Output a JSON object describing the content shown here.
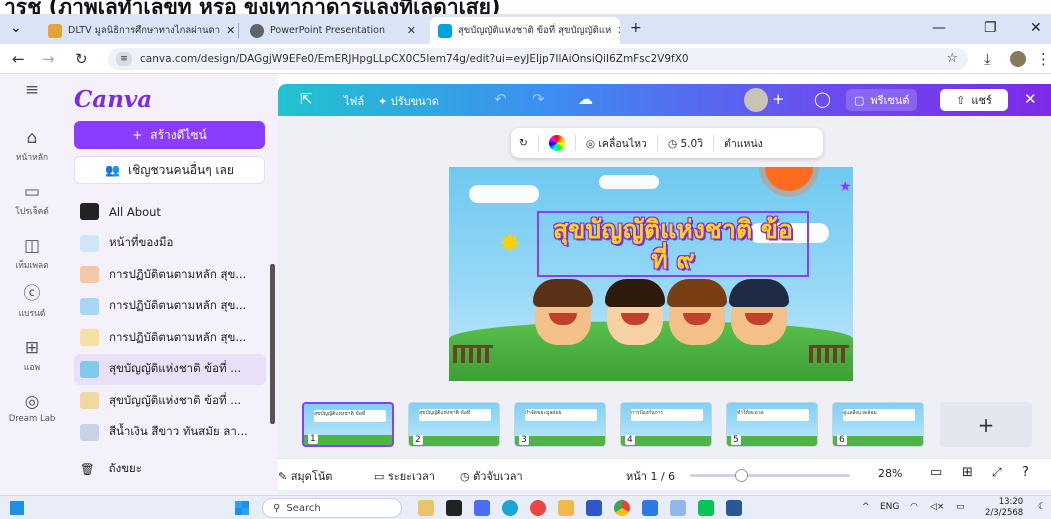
{
  "caption": "ารช (ภาพเลทำเลขท หรอ ขงเทากาดารแลงที่เลดาเสย)",
  "browser": {
    "tabs": [
      {
        "label": "DLTV มูลนิธิการศึกษาทางไกลผ่านดา",
        "favicon_color": "#e8a23a"
      },
      {
        "label": "PowerPoint Presentation",
        "favicon_color": "#5f6368"
      },
      {
        "label": "สุขบัญญัติแห่งชาติ ข้อที่ สุขบัญญัติแห",
        "favicon_color": "#00a3e0"
      }
    ],
    "new_tab": "+",
    "minimize": "—",
    "restore": "❐",
    "close": "✕",
    "url": "canva.com/design/DAGgjW9EFe0/EmERJHpgLLpCX0C5lem74g/edit?ui=eyJEIjp7IlAiOnsiQiI6ZmFsc2V9fX0"
  },
  "rail": [
    {
      "icon": "home-icon",
      "glyph": "⌂",
      "label": "หน้าหลัก"
    },
    {
      "icon": "folder-icon",
      "glyph": "▭",
      "label": "โปรเจ็คต์"
    },
    {
      "icon": "template-icon",
      "glyph": "◫",
      "label": "เท็มเพลต"
    },
    {
      "icon": "brand-icon",
      "glyph": "ⓒ",
      "label": "แบรนด์"
    },
    {
      "icon": "apps-icon",
      "glyph": "⊞",
      "label": "แอพ"
    },
    {
      "icon": "dreamlab-icon",
      "glyph": "◎",
      "label": "Dream Lab"
    }
  ],
  "panel": {
    "logo": "Canva",
    "create_label": "สร้างดีไซน์",
    "invite_label": "เชิญชวนคนอื่นๆ เลย",
    "items": [
      {
        "label": "All About",
        "thumb_color": "#222222"
      },
      {
        "label": "หน้าที่ของมือ",
        "thumb_color": "#cfe6f5"
      },
      {
        "label": "การปฏิบัติตนตามหลัก สุข...",
        "thumb_color": "#f3c7a8"
      },
      {
        "label": "การปฏิบัติตนตามหลัก สุข...",
        "thumb_color": "#a9d6f3"
      },
      {
        "label": "การปฏิบัติตนตามหลัก สุข...",
        "thumb_color": "#f5e2a2"
      },
      {
        "label": "สุขบัญญัติแห่งชาติ ข้อที่ ...",
        "thumb_color": "#7fc9ef"
      },
      {
        "label": "สุขบัญญัติแห่งชาติ ข้อที่ ...",
        "thumb_color": "#f1d8a0"
      },
      {
        "label": "สีน้ำเงิน สีขาว ทันสมัย ลา...",
        "thumb_color": "#c8d4e6"
      }
    ],
    "selected_index": 5,
    "trash_label": "ถังขยะ"
  },
  "editor": {
    "file_label": "ไฟล์",
    "resize_label": "ปรับขนาด",
    "present_label": "พรีเซนต์",
    "share_label": "แชร์",
    "toolbar": {
      "animate_label": "เคลื่อนไหว",
      "duration_label": "5.0วิ",
      "position_label": "ตำแหน่ง"
    }
  },
  "slide": {
    "title_line1": "สุขบัญญัติแห่งชาติ ข้อ",
    "title_line2": "ที่ ๙"
  },
  "thumbnails": [
    {
      "num": "1",
      "title": "สุขบัญญัติแห่งชาติ ข้อที่"
    },
    {
      "num": "2",
      "title": "สุขบัญญัติแห่งชาติ ข้อที่"
    },
    {
      "num": "3",
      "title": "กำจัดขยะมูลฝอย"
    },
    {
      "num": "4",
      "title": "การป้องกันการ"
    },
    {
      "num": "5",
      "title": "ทำให้สะอาด"
    },
    {
      "num": "6",
      "title": "ดูแลสิ่งแวดล้อม"
    }
  ],
  "add_page": "+",
  "bottom": {
    "notes_label": "สมุดโน้ต",
    "duration_label": "ระยะเวลา",
    "timer_label": "ตัวจับเวลา",
    "page_label": "หน้า 1 / 6",
    "zoom": "28%",
    "zoom_fraction": 0.28
  },
  "taskbar": {
    "search_placeholder": "Search",
    "lang": "ENG",
    "time": "13:20",
    "date": "2/3/2568"
  }
}
